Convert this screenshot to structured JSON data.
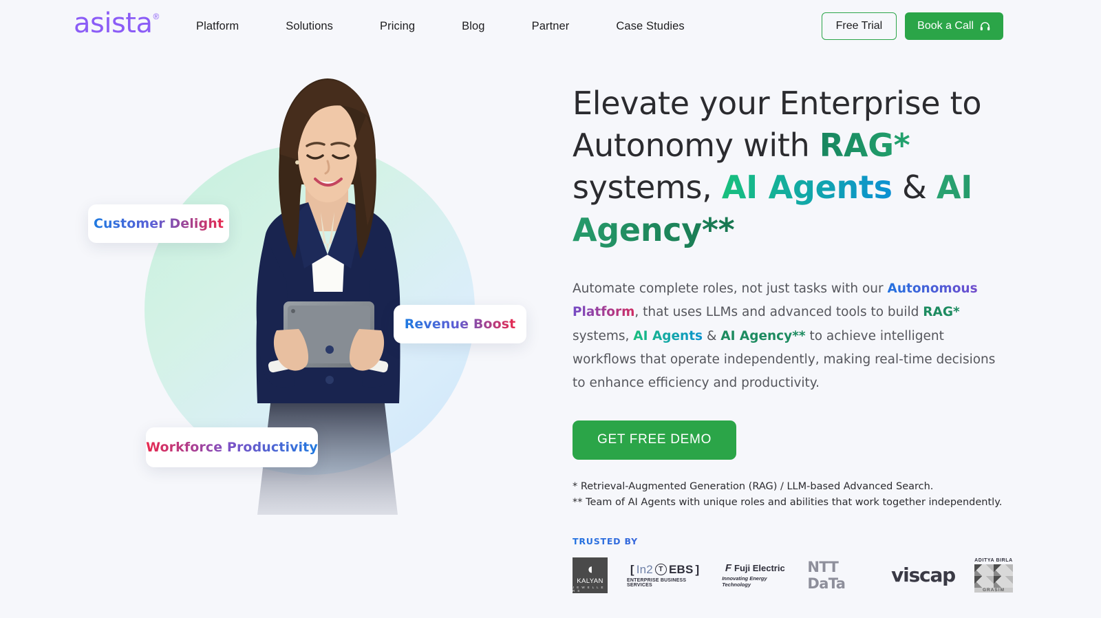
{
  "brand": {
    "name": "asista",
    "trademark": "®",
    "color": "#8b5cf6"
  },
  "header": {
    "nav": [
      {
        "label": "Platform"
      },
      {
        "label": "Solutions"
      },
      {
        "label": "Pricing"
      },
      {
        "label": "Blog"
      },
      {
        "label": "Partner"
      },
      {
        "label": "Case Studies"
      }
    ],
    "free_trial_label": "Free Trial",
    "book_call_label": "Book a Call",
    "book_call_icon": "headset-icon",
    "accent_green": "#2ba548"
  },
  "hero": {
    "headline": {
      "part1": "Elevate your Enterprise to Autonomy with ",
      "rag": "RAG*",
      "part2": " systems, ",
      "ai_agents": "AI Agents",
      "part3": " & ",
      "ai_agency": "AI Agency**"
    },
    "subcopy": {
      "p1": "Automate complete roles, not just tasks with our ",
      "autonomous_platform": "Autonomous Platform",
      "p2": ", that uses LLMs and advanced tools to build ",
      "rag": "RAG*",
      "p3": " systems, ",
      "ai_agents": "AI Agents",
      "p4": " & ",
      "ai_agency": "AI Agency**",
      "p5": " to achieve intelligent workflows that operate independently, making real-time decisions to enhance efficiency and productivity."
    },
    "cta_label": "GET FREE DEMO",
    "footnote_1": "* Retrieval-Augmented Generation (RAG) / LLM-based Advanced Search.",
    "footnote_2": "** Team of AI Agents with unique roles and abilities that work together independently.",
    "cards": [
      {
        "label": "Customer Delight"
      },
      {
        "label": "Revenue Boost"
      },
      {
        "label": "Workforce Productivity"
      }
    ],
    "image_alt": "businesswoman-with-tablet"
  },
  "trusted": {
    "label": "TRUSTED BY",
    "logos": [
      {
        "name": "kalyan-jewellers-logo",
        "mark": "◖",
        "title": "KALYAN",
        "subtitle": "J E W E L L E R S"
      },
      {
        "name": "in2-ebs-logo",
        "bracket_open": "[",
        "in2": "In2",
        "circle": "T",
        "ebs": "EBS",
        "bracket_close": "]",
        "subtitle": "ENTERPRISE BUSINESS SERVICES"
      },
      {
        "name": "fuji-electric-logo",
        "mark": "F",
        "title": "Fuji Electric",
        "subtitle": "Innovating Energy Technology"
      },
      {
        "name": "ntt-data-logo",
        "title": "NTT DaTa"
      },
      {
        "name": "viscap-logo",
        "title": "viscap"
      },
      {
        "name": "aditya-birla-grasim-logo",
        "title": "ADITYA BIRLA",
        "subtitle": "GRASIM"
      }
    ]
  }
}
